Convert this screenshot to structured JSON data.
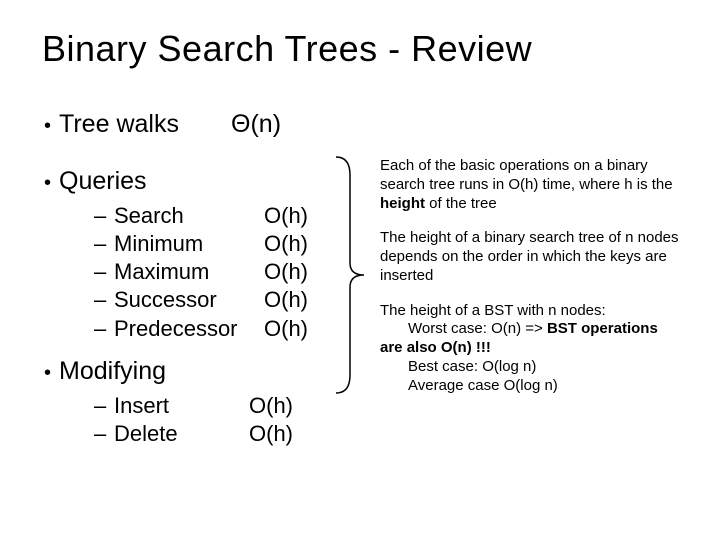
{
  "title": "Binary Search Trees - Review",
  "treewalks": {
    "label": "Tree walks",
    "complexity": "Θ(n)"
  },
  "queries": {
    "label": "Queries",
    "items": [
      {
        "label": "Search",
        "complexity": "O(h)"
      },
      {
        "label": "Minimum",
        "complexity": "O(h)"
      },
      {
        "label": "Maximum",
        "complexity": "O(h)"
      },
      {
        "label": "Successor",
        "complexity": "O(h)"
      },
      {
        "label": "Predecessor",
        "complexity": "O(h)"
      }
    ]
  },
  "modifying": {
    "label": "Modifying",
    "items": [
      {
        "label": "Insert",
        "complexity": "O(h)"
      },
      {
        "label": "Delete",
        "complexity": "O(h)"
      }
    ]
  },
  "notes": {
    "p1a": "Each of the basic operations on a binary search tree runs in O(h) time, where h is the ",
    "p1b": "height",
    "p1c": " of the tree",
    "p2": "The height of a binary search tree of n nodes depends on the order in which the keys are inserted",
    "p3a": "The height of a BST with n nodes:",
    "p3b": "Worst case: O(n) => ",
    "p3c": "BST operations are also O(n) !!!",
    "p3d": "Best case:  O(log n)",
    "p3e": "Average case O(log n)"
  }
}
